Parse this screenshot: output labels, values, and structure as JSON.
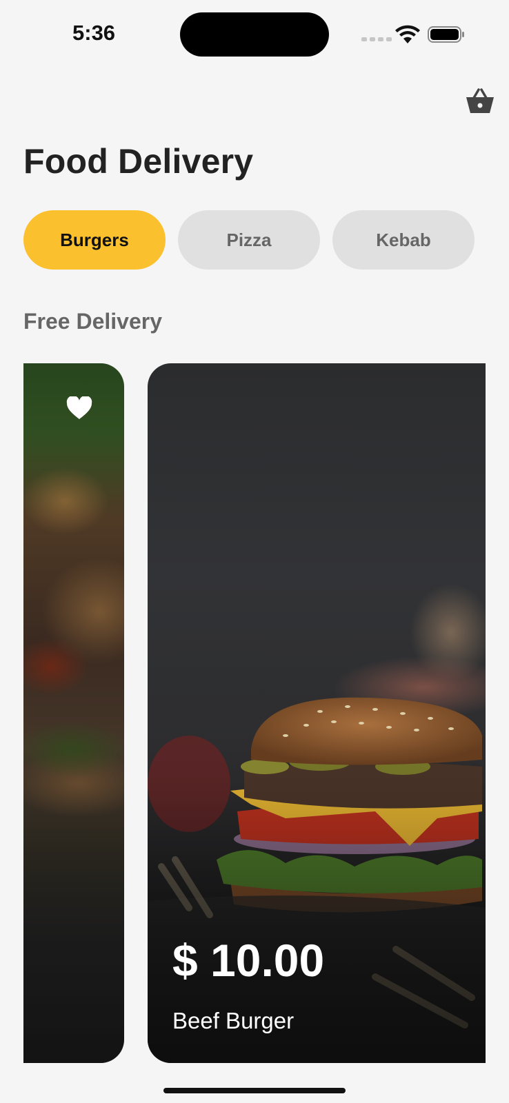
{
  "status_bar": {
    "time": "5:36"
  },
  "header": {
    "title": "Food Delivery",
    "cart_icon": "basket-icon"
  },
  "categories": [
    {
      "label": "Burgers",
      "active": true
    },
    {
      "label": "Pizza",
      "active": false
    },
    {
      "label": "Kebab",
      "active": false
    }
  ],
  "section": {
    "title": "Free Delivery"
  },
  "cards": [
    {
      "icon": "heart-icon"
    },
    {
      "price": "$ 10.00",
      "name": "Beef Burger"
    }
  ],
  "colors": {
    "accent": "#fbc02d",
    "background": "#f5f5f5",
    "pill_inactive": "#e0e0e0"
  }
}
